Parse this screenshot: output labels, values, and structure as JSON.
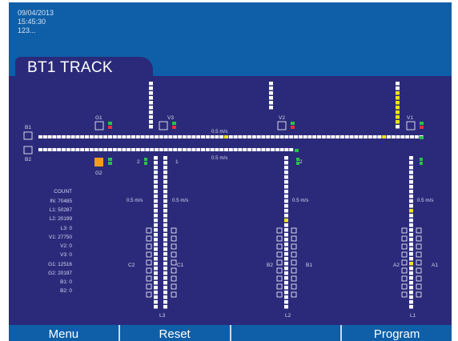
{
  "header": {
    "date": "09/04/2013",
    "time": "15:45:30",
    "info": "123..."
  },
  "tab": {
    "title": "BT1 TRACK"
  },
  "track": {
    "labels": {
      "b1": "B1",
      "b2": "B2",
      "g1": "G1",
      "g2": "G2",
      "v1": "V1",
      "v2": "V2",
      "v3": "V3",
      "l1": "L1",
      "l2": "L2",
      "l3": "L3",
      "a1": "A1",
      "a2": "A2",
      "b1b": "B1",
      "b2b": "B2",
      "c1": "C1",
      "c2": "C2",
      "num1": "1",
      "num2a": "2",
      "num2b": "2"
    },
    "speeds": {
      "main_top": "0.5 m/s",
      "main_bottom": "0.5 m/s",
      "l3_left": "0.5 m/s",
      "l3_right": "0.5 m/s",
      "l2": "0.5 m/s",
      "l1": "0.5 m/s"
    },
    "colors": {
      "cell": "#ffffff",
      "active": "#f2e21c",
      "orange": "#f59a1e",
      "signal_green": "#29c24a",
      "signal_red": "#e3323c"
    }
  },
  "counts": {
    "title": "COUNT",
    "rows": [
      "IN: 70485",
      "L1: 50287",
      "L2: 20199",
      "L3: 0",
      "V1: 27750",
      "V2: 0",
      "V3: 0",
      "G1: 12516",
      "G2: 20197",
      "B1: 0",
      "B2: 0"
    ]
  },
  "footer": {
    "buttons": [
      "Menu",
      "Reset",
      "",
      "Program"
    ]
  }
}
